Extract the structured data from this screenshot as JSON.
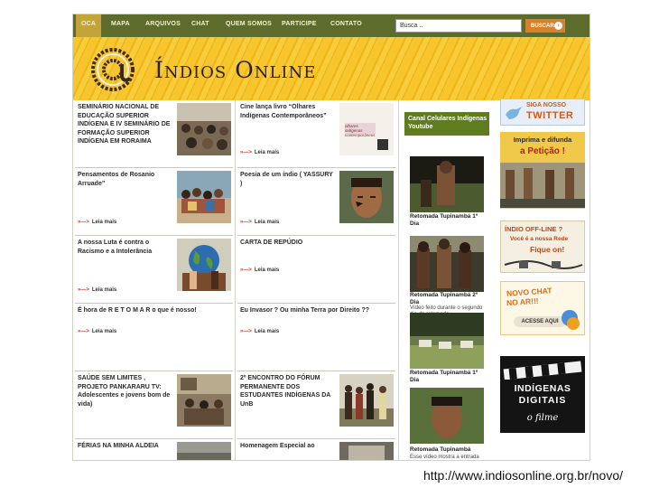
{
  "nav": {
    "items": [
      "OCA",
      "MAPA",
      "ARQUIVOS",
      "CHAT",
      "QUEM SOMOS",
      "PARTICIPE",
      "CONTATO"
    ],
    "search_placeholder": "Busca ..",
    "search_button": "BUSCAR"
  },
  "banner": {
    "title": "Índios Online"
  },
  "posts": [
    {
      "title": "SEMINÁRIO NACIONAL DE EDUCAÇÃO SUPERIOR INDÍGENA E IV SEMINÁRIO DE FORMAÇÃO SUPERIOR INDÍGENA EM RORAIMA",
      "more": ""
    },
    {
      "title": "Cine lança livro “Olhares Indígenas Contemporâneos”",
      "more": "Leia mais",
      "thumb_caption": "olhares indígenas contemporâneos"
    },
    {
      "title": "Pensamentos de Rosanio Arruade”",
      "more": "Leia mais"
    },
    {
      "title": "Poesia de um índio ( YASSURY )",
      "more": "Leia mais"
    },
    {
      "title": "A nossa Luta é contra o Racismo e a Intolerância",
      "more": "Leia mais"
    },
    {
      "title": "CARTA DE REPÚDIO",
      "more": "Leia mais"
    },
    {
      "title": "É hora de R E T O M A R o que é nosso!",
      "more": "Leia mais"
    },
    {
      "title": "Eu Invasor ? Ou minha Terra por Direito ??",
      "more": "Leia mais"
    },
    {
      "title": "SAÚDE SEM LIMITES , PROJETO PANKARARU TV: Adolescentes e jovens bom de vida)",
      "more": ""
    },
    {
      "title": "2º ENCONTRO DO FÓRUM PERMANENTE DOS ESTUDANTES INDÍGENAS DA UnB",
      "more": ""
    },
    {
      "title": "FÉRIAS NA MINHA ALDEIA",
      "more": ""
    },
    {
      "title": "Homenagem Especial ao",
      "more": ""
    }
  ],
  "video_column": {
    "header": "Canal Celulares Indígenas Youtube",
    "videos": [
      {
        "title": "Retomada Tupinambá 1º Dia",
        "desc": ""
      },
      {
        "title": "Retomada Tupinambá 2º Dia",
        "desc": "Vídeo feito durante o segundo dia de retomada"
      },
      {
        "title": "Retomada Tupinambá 1º Dia",
        "desc": ""
      },
      {
        "title": "Retomada Tupinambá",
        "desc": "Esse vídeo mostra a entrada"
      }
    ]
  },
  "ads": {
    "twitter": {
      "line1": "SIGA NOSSO",
      "line2": "TWITTER"
    },
    "peticao": {
      "line1": "Imprima e difunda",
      "line2": "a Petição !"
    },
    "offline": {
      "line1": "ÍNDIO OFF-LINE ?",
      "line2": "Você é a nossa Rede",
      "line3": "Fique on!"
    },
    "chat": {
      "line1": "NOVO CHAT",
      "line2": "NO AR!!!",
      "line3": "ACESSE AQUI"
    },
    "film": {
      "line1": "INDÍGENAS",
      "line2": "DIGITAIS",
      "line3": "o filme"
    }
  },
  "footer_url": "http://www.indiosonline.org.br/novo/",
  "colors": {
    "nav": "#5d6b2c",
    "nav_active": "#c3a43a",
    "banner": "#f7c52e",
    "video_header": "#5f7d1f",
    "accent": "#d8812a"
  }
}
